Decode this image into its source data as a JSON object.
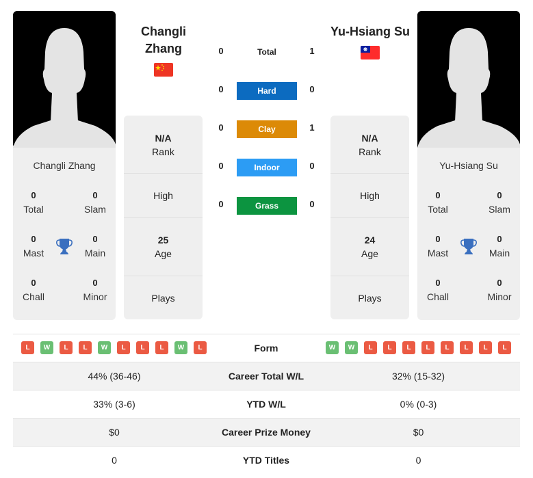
{
  "player1": {
    "name": "Changli Zhang",
    "name_line1": "Changli",
    "name_line2": "Zhang",
    "country_flag": "china-flag",
    "stats": {
      "total": {
        "value": "0",
        "label": "Total"
      },
      "slam": {
        "value": "0",
        "label": "Slam"
      },
      "mast": {
        "value": "0",
        "label": "Mast"
      },
      "main": {
        "value": "0",
        "label": "Main"
      },
      "chall": {
        "value": "0",
        "label": "Chall"
      },
      "minor": {
        "value": "0",
        "label": "Minor"
      }
    },
    "info": {
      "rank_value": "N/A",
      "rank_label": "Rank",
      "high_label": "High",
      "age_value": "25",
      "age_label": "Age",
      "plays_label": "Plays"
    },
    "form": [
      "L",
      "W",
      "L",
      "L",
      "W",
      "L",
      "L",
      "L",
      "W",
      "L"
    ]
  },
  "player2": {
    "name": "Yu-Hsiang Su",
    "country_flag": "taiwan-flag",
    "stats": {
      "total": {
        "value": "0",
        "label": "Total"
      },
      "slam": {
        "value": "0",
        "label": "Slam"
      },
      "mast": {
        "value": "0",
        "label": "Mast"
      },
      "main": {
        "value": "0",
        "label": "Main"
      },
      "chall": {
        "value": "0",
        "label": "Chall"
      },
      "minor": {
        "value": "0",
        "label": "Minor"
      }
    },
    "info": {
      "rank_value": "N/A",
      "rank_label": "Rank",
      "high_label": "High",
      "age_value": "24",
      "age_label": "Age",
      "plays_label": "Plays"
    },
    "form": [
      "W",
      "W",
      "L",
      "L",
      "L",
      "L",
      "L",
      "L",
      "L",
      "L"
    ]
  },
  "h2h": {
    "total": {
      "label": "Total",
      "p1": "0",
      "p2": "1"
    },
    "surfaces": [
      {
        "label": "Hard",
        "p1": "0",
        "p2": "0",
        "color": "#0c6bc0"
      },
      {
        "label": "Clay",
        "p1": "0",
        "p2": "1",
        "color": "#dc8a07"
      },
      {
        "label": "Indoor",
        "p1": "0",
        "p2": "0",
        "color": "#2c9cf4"
      },
      {
        "label": "Grass",
        "p1": "0",
        "p2": "0",
        "color": "#0c9440"
      }
    ]
  },
  "comparison": {
    "form_label": "Form",
    "rows": [
      {
        "label": "Career Total W/L",
        "p1": "44% (36-46)",
        "p2": "32% (15-32)"
      },
      {
        "label": "YTD W/L",
        "p1": "33% (3-6)",
        "p2": "0% (0-3)"
      },
      {
        "label": "Career Prize Money",
        "p1": "$0",
        "p2": "$0"
      },
      {
        "label": "YTD Titles",
        "p1": "0",
        "p2": "0"
      }
    ]
  },
  "colors": {
    "win": "#6abf73",
    "loss": "#eb5a43",
    "trophy": "#3a6fbf"
  }
}
